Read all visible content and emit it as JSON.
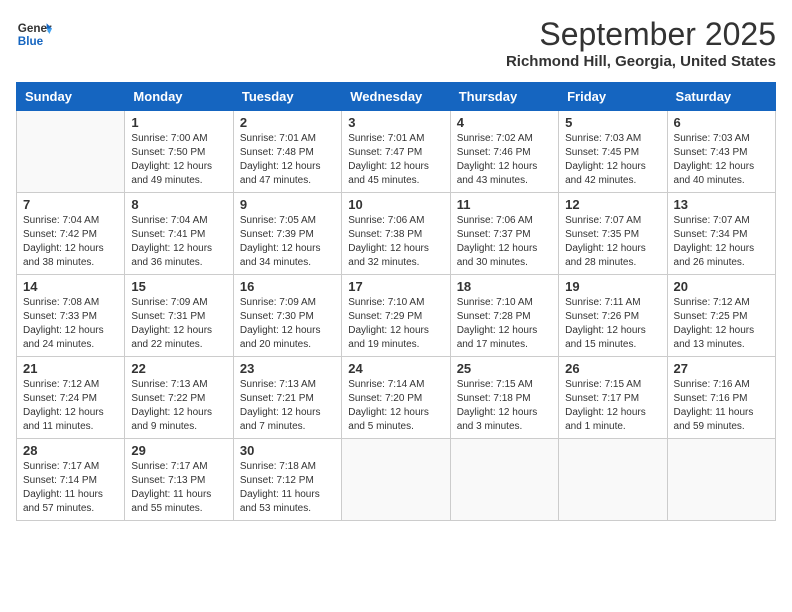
{
  "header": {
    "logo_line1": "General",
    "logo_line2": "Blue",
    "month": "September 2025",
    "location": "Richmond Hill, Georgia, United States"
  },
  "weekdays": [
    "Sunday",
    "Monday",
    "Tuesday",
    "Wednesday",
    "Thursday",
    "Friday",
    "Saturday"
  ],
  "weeks": [
    [
      null,
      {
        "day": 1,
        "sunrise": "7:00 AM",
        "sunset": "7:50 PM",
        "daylight": "12 hours and 49 minutes."
      },
      {
        "day": 2,
        "sunrise": "7:01 AM",
        "sunset": "7:48 PM",
        "daylight": "12 hours and 47 minutes."
      },
      {
        "day": 3,
        "sunrise": "7:01 AM",
        "sunset": "7:47 PM",
        "daylight": "12 hours and 45 minutes."
      },
      {
        "day": 4,
        "sunrise": "7:02 AM",
        "sunset": "7:46 PM",
        "daylight": "12 hours and 43 minutes."
      },
      {
        "day": 5,
        "sunrise": "7:03 AM",
        "sunset": "7:45 PM",
        "daylight": "12 hours and 42 minutes."
      },
      {
        "day": 6,
        "sunrise": "7:03 AM",
        "sunset": "7:43 PM",
        "daylight": "12 hours and 40 minutes."
      }
    ],
    [
      {
        "day": 7,
        "sunrise": "7:04 AM",
        "sunset": "7:42 PM",
        "daylight": "12 hours and 38 minutes."
      },
      {
        "day": 8,
        "sunrise": "7:04 AM",
        "sunset": "7:41 PM",
        "daylight": "12 hours and 36 minutes."
      },
      {
        "day": 9,
        "sunrise": "7:05 AM",
        "sunset": "7:39 PM",
        "daylight": "12 hours and 34 minutes."
      },
      {
        "day": 10,
        "sunrise": "7:06 AM",
        "sunset": "7:38 PM",
        "daylight": "12 hours and 32 minutes."
      },
      {
        "day": 11,
        "sunrise": "7:06 AM",
        "sunset": "7:37 PM",
        "daylight": "12 hours and 30 minutes."
      },
      {
        "day": 12,
        "sunrise": "7:07 AM",
        "sunset": "7:35 PM",
        "daylight": "12 hours and 28 minutes."
      },
      {
        "day": 13,
        "sunrise": "7:07 AM",
        "sunset": "7:34 PM",
        "daylight": "12 hours and 26 minutes."
      }
    ],
    [
      {
        "day": 14,
        "sunrise": "7:08 AM",
        "sunset": "7:33 PM",
        "daylight": "12 hours and 24 minutes."
      },
      {
        "day": 15,
        "sunrise": "7:09 AM",
        "sunset": "7:31 PM",
        "daylight": "12 hours and 22 minutes."
      },
      {
        "day": 16,
        "sunrise": "7:09 AM",
        "sunset": "7:30 PM",
        "daylight": "12 hours and 20 minutes."
      },
      {
        "day": 17,
        "sunrise": "7:10 AM",
        "sunset": "7:29 PM",
        "daylight": "12 hours and 19 minutes."
      },
      {
        "day": 18,
        "sunrise": "7:10 AM",
        "sunset": "7:28 PM",
        "daylight": "12 hours and 17 minutes."
      },
      {
        "day": 19,
        "sunrise": "7:11 AM",
        "sunset": "7:26 PM",
        "daylight": "12 hours and 15 minutes."
      },
      {
        "day": 20,
        "sunrise": "7:12 AM",
        "sunset": "7:25 PM",
        "daylight": "12 hours and 13 minutes."
      }
    ],
    [
      {
        "day": 21,
        "sunrise": "7:12 AM",
        "sunset": "7:24 PM",
        "daylight": "12 hours and 11 minutes."
      },
      {
        "day": 22,
        "sunrise": "7:13 AM",
        "sunset": "7:22 PM",
        "daylight": "12 hours and 9 minutes."
      },
      {
        "day": 23,
        "sunrise": "7:13 AM",
        "sunset": "7:21 PM",
        "daylight": "12 hours and 7 minutes."
      },
      {
        "day": 24,
        "sunrise": "7:14 AM",
        "sunset": "7:20 PM",
        "daylight": "12 hours and 5 minutes."
      },
      {
        "day": 25,
        "sunrise": "7:15 AM",
        "sunset": "7:18 PM",
        "daylight": "12 hours and 3 minutes."
      },
      {
        "day": 26,
        "sunrise": "7:15 AM",
        "sunset": "7:17 PM",
        "daylight": "12 hours and 1 minute."
      },
      {
        "day": 27,
        "sunrise": "7:16 AM",
        "sunset": "7:16 PM",
        "daylight": "11 hours and 59 minutes."
      }
    ],
    [
      {
        "day": 28,
        "sunrise": "7:17 AM",
        "sunset": "7:14 PM",
        "daylight": "11 hours and 57 minutes."
      },
      {
        "day": 29,
        "sunrise": "7:17 AM",
        "sunset": "7:13 PM",
        "daylight": "11 hours and 55 minutes."
      },
      {
        "day": 30,
        "sunrise": "7:18 AM",
        "sunset": "7:12 PM",
        "daylight": "11 hours and 53 minutes."
      },
      null,
      null,
      null,
      null
    ]
  ]
}
